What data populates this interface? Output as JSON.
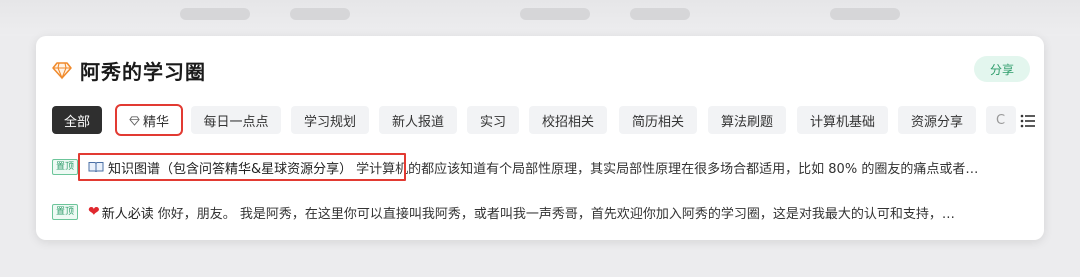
{
  "circle": {
    "title": "阿秀的学习圈",
    "share_label": "分享"
  },
  "tabs": [
    {
      "label": "全部",
      "active": true
    },
    {
      "label": "精华",
      "icon": "gem-icon",
      "highlighted": true
    },
    {
      "label": "每日一点点"
    },
    {
      "label": "学习规划"
    },
    {
      "label": "新人报道"
    },
    {
      "label": "实习"
    },
    {
      "label": "校招相关"
    },
    {
      "label": "简历相关"
    },
    {
      "label": "算法刷题"
    },
    {
      "label": "计算机基础"
    },
    {
      "label": "资源分享"
    },
    {
      "label": "C"
    }
  ],
  "posts": [
    {
      "pin_label": "置顶",
      "title": "知识图谱（包含问答精华&星球资源分享）",
      "title_icon": "book-icon",
      "excerpt": "学计算机的都应该知道有个局部性原理，其实局部性原理在很多场合都适用，比如 80% 的圈友的痛点或者…",
      "highlighted": true
    },
    {
      "pin_label": "置顶",
      "title": "新人必读",
      "title_icon": "heart-icon",
      "excerpt": "你好，朋友。 我是阿秀，在这里你可以直接叫我阿秀，或者叫我一声秀哥，首先欢迎你加入阿秀的学习圈，这是对我最大的认可和支持，…"
    }
  ],
  "colors": {
    "accent_green": "#2d9c6a",
    "highlight_red": "#e23a32",
    "active_tab": "#2f2f2f"
  }
}
